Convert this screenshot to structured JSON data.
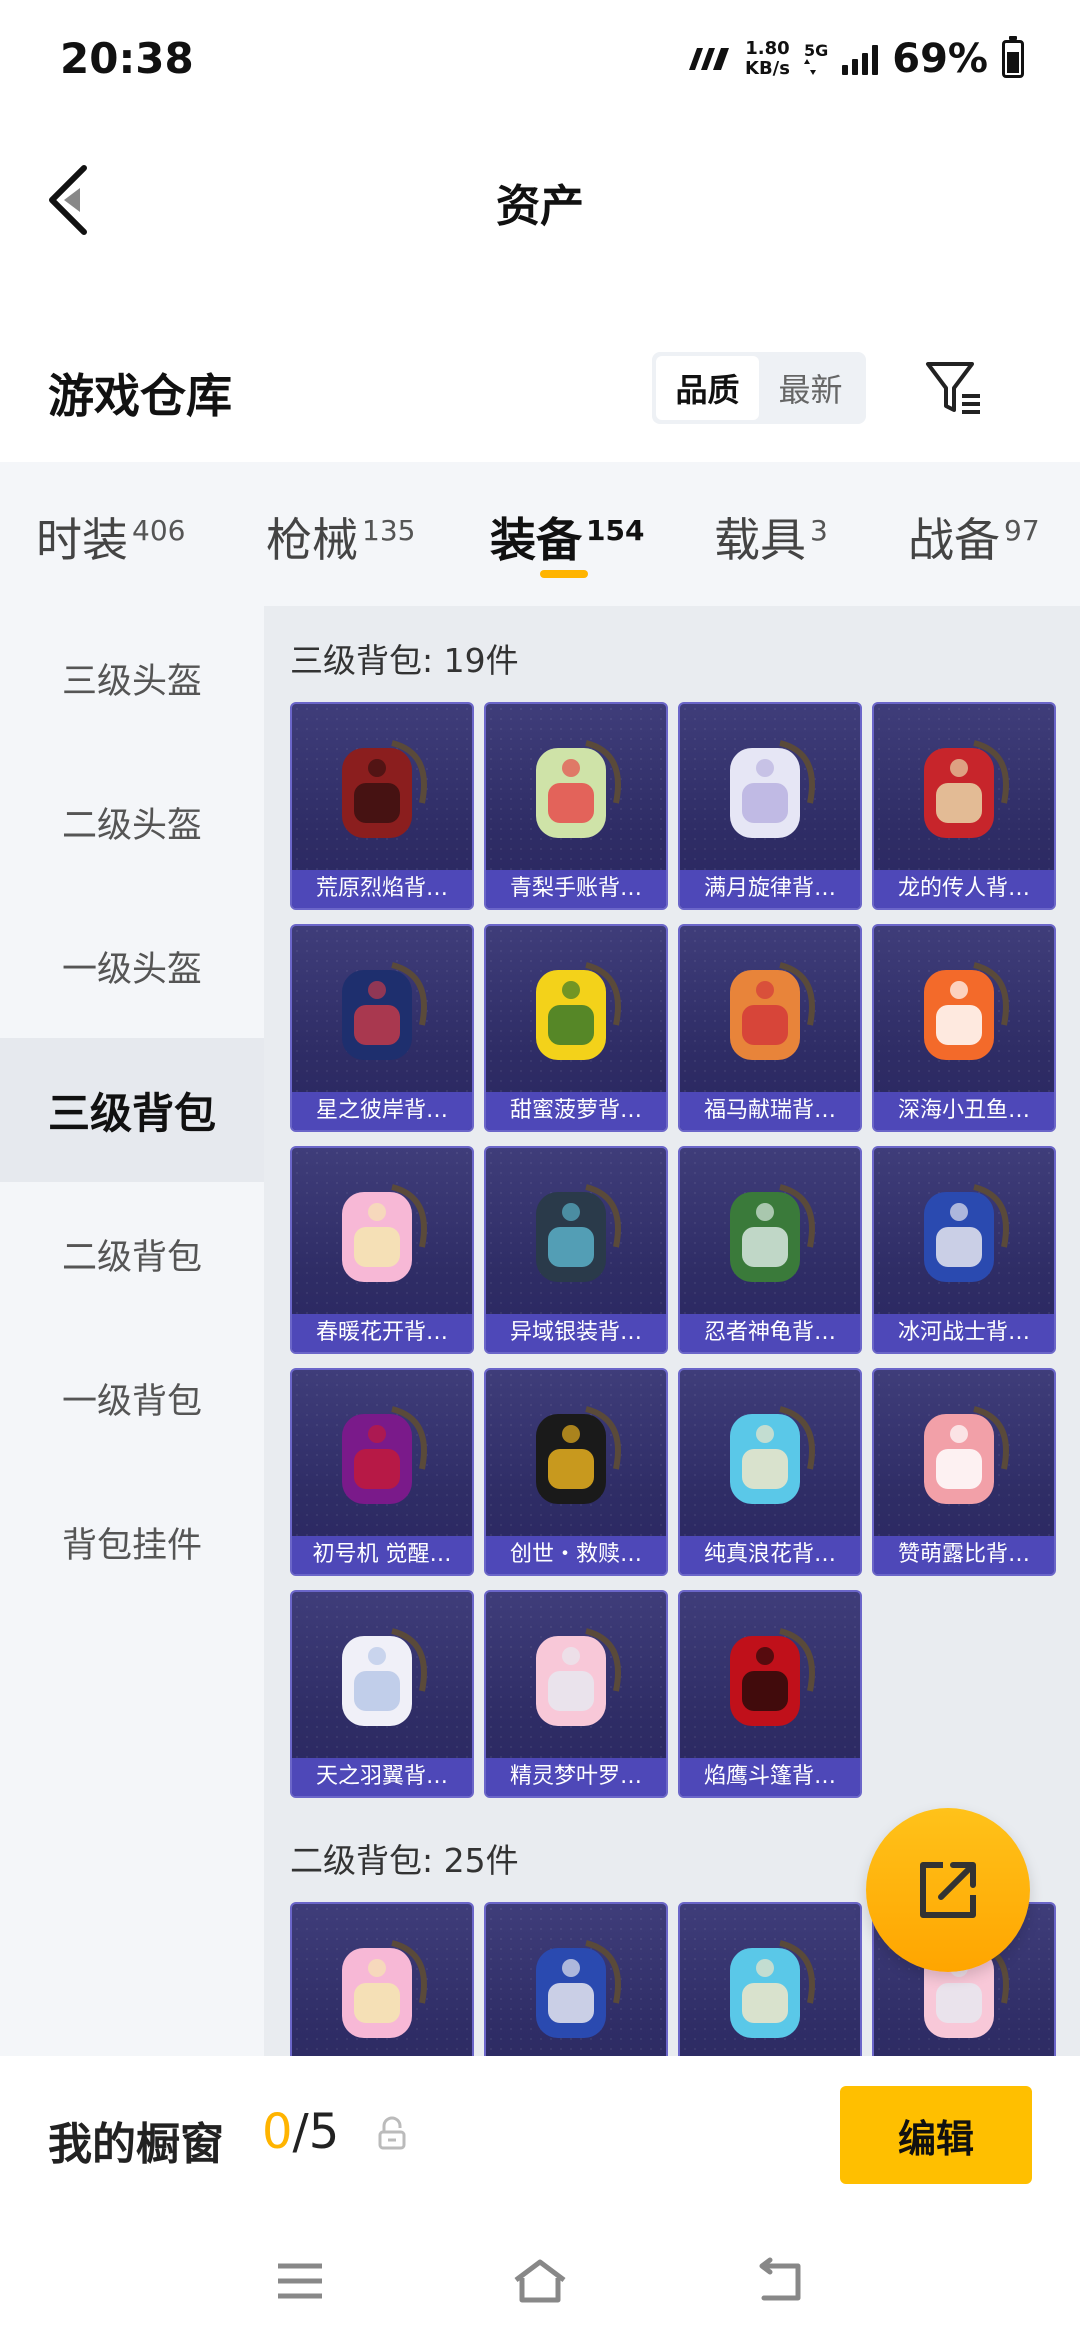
{
  "status_bar": {
    "time": "20:38",
    "speed_value": "1.80",
    "speed_unit": "KB/s",
    "network": "5G",
    "battery": "69%"
  },
  "nav": {
    "title": "资产"
  },
  "warehouse": {
    "title": "游戏仓库",
    "sort_options": [
      "品质",
      "最新"
    ]
  },
  "categories": [
    {
      "label": "时装",
      "count": "406"
    },
    {
      "label": "枪械",
      "count": "135"
    },
    {
      "label": "装备",
      "count": "154"
    },
    {
      "label": "载具",
      "count": "3"
    },
    {
      "label": "战备",
      "count": "97"
    }
  ],
  "sidebar": {
    "items": [
      "三级头盔",
      "二级头盔",
      "一级头盔",
      "三级背包",
      "二级背包",
      "一级背包",
      "背包挂件"
    ]
  },
  "sections": [
    {
      "title": "三级背包: 19件",
      "items": [
        "荒原烈焰背…",
        "青梨手账背…",
        "满月旋律背…",
        "龙的传人背…",
        "星之彼岸背…",
        "甜蜜菠萝背…",
        "福马献瑞背…",
        "深海小丑鱼…",
        "春暖花开背…",
        "异域银装背…",
        "忍者神龟背…",
        "冰河战士背…",
        "初号机 觉醒…",
        "创世・救赎…",
        "纯真浪花背…",
        "赞萌露比背…",
        "天之羽翼背…",
        "精灵梦叶罗…",
        "焰鹰斗篷背…"
      ]
    },
    {
      "title": "二级背包: 25件"
    }
  ],
  "showcase": {
    "label": "我的橱窗",
    "current": "0",
    "sep_total": "/5",
    "edit_label": "编辑"
  },
  "colors": {
    "accent": "#ffb400",
    "card_bg": "#35336e",
    "card_label": "#4e48b8"
  }
}
